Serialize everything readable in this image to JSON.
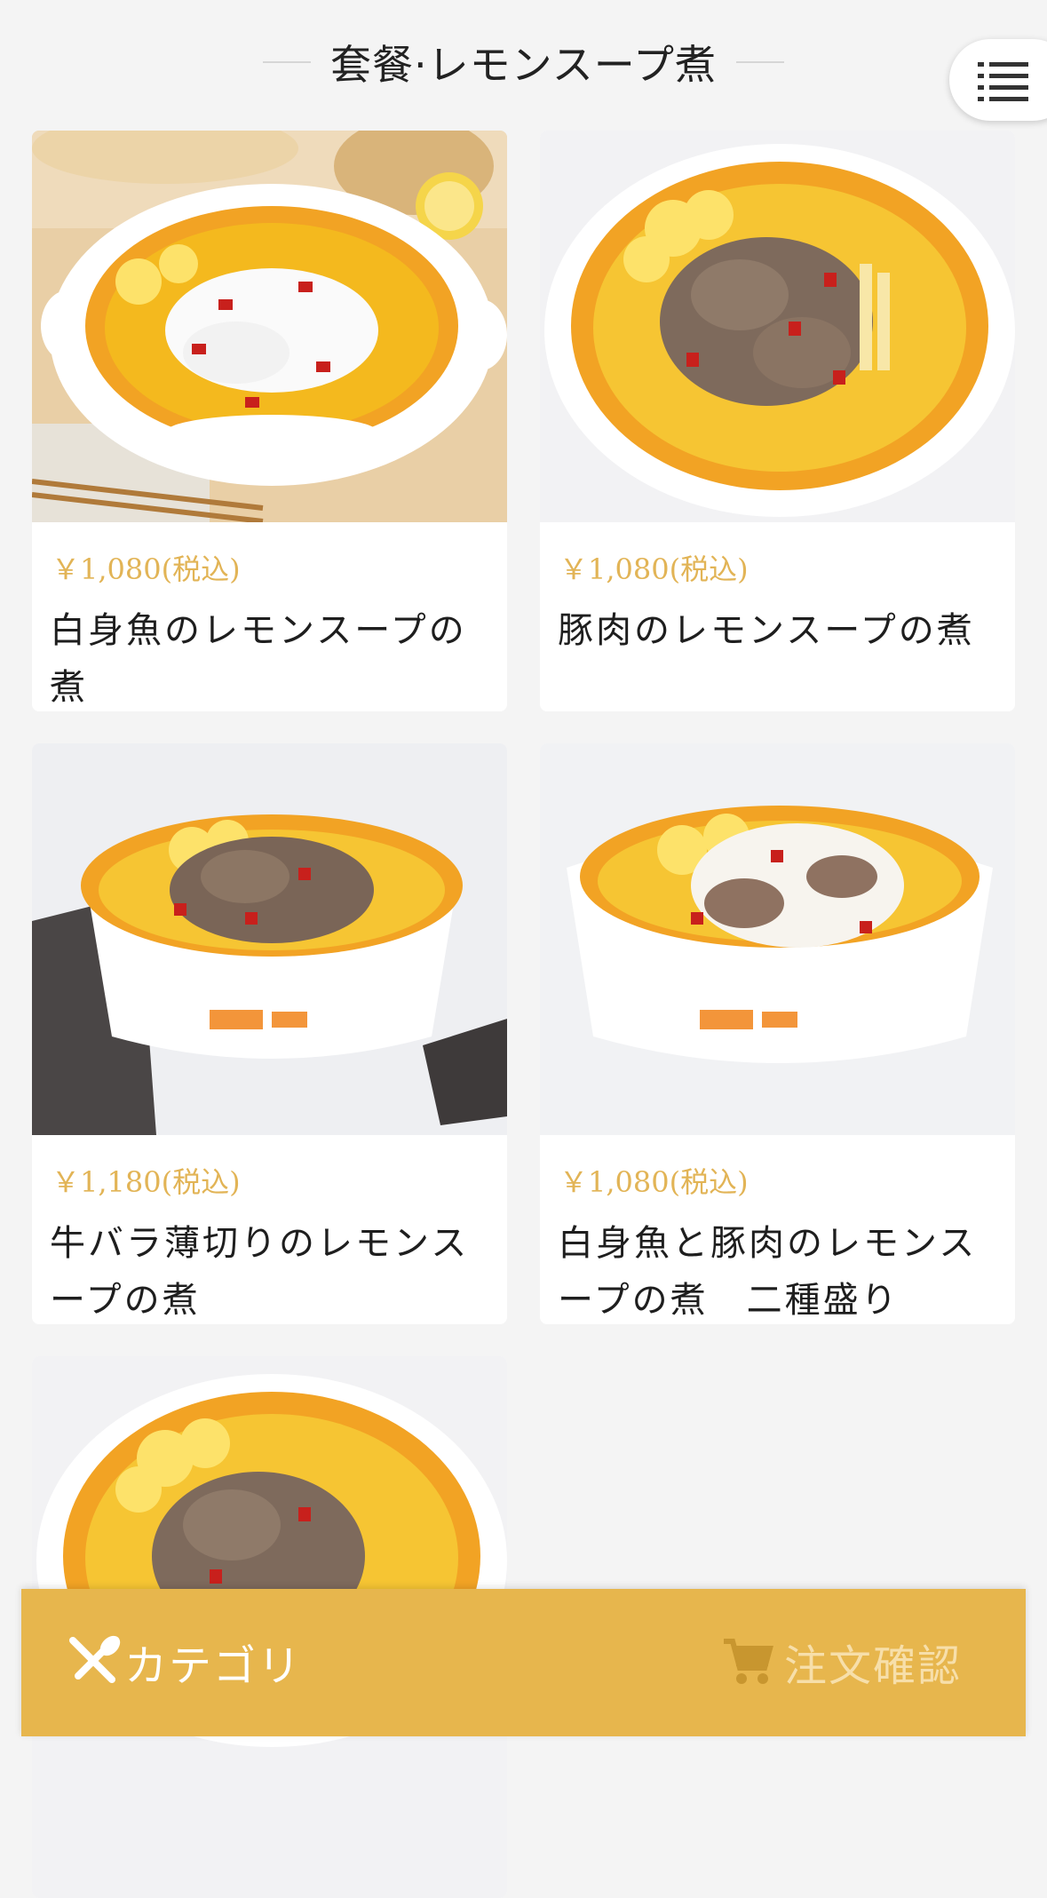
{
  "header": {
    "title": "套餐·レモンスープ煮"
  },
  "menu_button": {
    "icon": "list-icon"
  },
  "items": [
    {
      "price": "￥1,080(税込)",
      "name": "白身魚のレモンスープの煮",
      "dish": "white-fish"
    },
    {
      "price": "￥1,080(税込)",
      "name": "豚肉のレモンスープの煮",
      "dish": "pork"
    },
    {
      "price": "￥1,180(税込)",
      "name": "牛バラ薄切りのレモンスープの煮",
      "dish": "beef"
    },
    {
      "price": "￥1,080(税込)",
      "name": "白身魚と豚肉のレモンスープの煮　二種盛り",
      "dish": "mixed"
    },
    {
      "price": "",
      "name": "",
      "dish": "pork"
    }
  ],
  "bottom_bar": {
    "category_label": "カテゴリ",
    "order_label": "注文確認",
    "category_icon": "utensils-icon",
    "order_icon": "cart-icon"
  },
  "colors": {
    "accent": "#e7b64d",
    "price": "#e2b456",
    "background": "#f4f4f4",
    "soup": "#f2b21c"
  }
}
